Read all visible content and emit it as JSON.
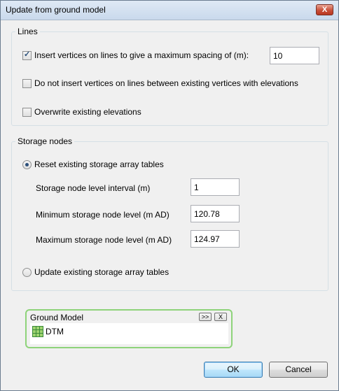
{
  "window": {
    "title": "Update from ground model",
    "close_label": "X"
  },
  "lines": {
    "legend": "Lines",
    "insert_vertices": {
      "label": "Insert vertices on lines to give a maximum spacing of (m):",
      "checked": true,
      "value": "10"
    },
    "no_insert_between": {
      "label": "Do not insert vertices on lines between existing vertices with elevations",
      "checked": false
    },
    "overwrite": {
      "label": "Overwrite existing elevations",
      "checked": false
    }
  },
  "storage": {
    "legend": "Storage nodes",
    "reset_label": "Reset existing storage array tables",
    "reset_selected": true,
    "interval": {
      "label": "Storage node level interval (m)",
      "value": "1"
    },
    "minimum": {
      "label": "Minimum storage node level (m AD)",
      "value": "120.78"
    },
    "maximum": {
      "label": "Maximum storage node level (m AD)",
      "value": "124.97"
    },
    "update_label": "Update existing storage array tables",
    "update_selected": false
  },
  "ground_model": {
    "title": "Ground Model",
    "expand_label": ">>",
    "clear_label": "X",
    "items": [
      {
        "label": "DTM",
        "icon": "grid-icon"
      }
    ],
    "border_color": "#8ed37a"
  },
  "buttons": {
    "ok": "OK",
    "cancel": "Cancel"
  }
}
